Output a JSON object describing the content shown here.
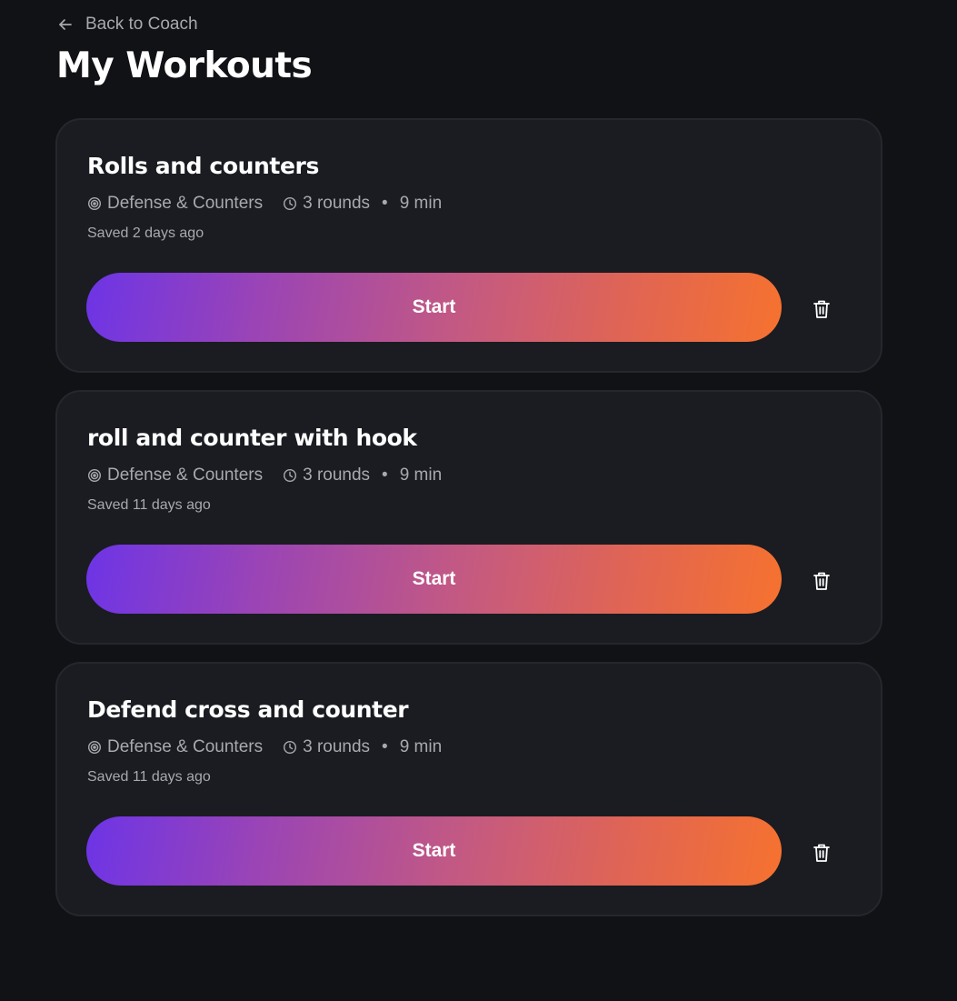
{
  "nav": {
    "back_label": "Back to Coach"
  },
  "page": {
    "title": "My Workouts"
  },
  "workouts": [
    {
      "title": "Rolls and counters",
      "category": "Defense & Counters",
      "rounds": "3 rounds",
      "duration": "9 min",
      "saved": "Saved 2 days ago",
      "start_label": "Start"
    },
    {
      "title": "roll and counter with hook",
      "category": "Defense & Counters",
      "rounds": "3 rounds",
      "duration": "9 min",
      "saved": "Saved 11 days ago",
      "start_label": "Start"
    },
    {
      "title": "Defend cross and counter",
      "category": "Defense & Counters",
      "rounds": "3 rounds",
      "duration": "9 min",
      "saved": "Saved 11 days ago",
      "start_label": "Start"
    }
  ],
  "meta_separator": "•",
  "icons": {
    "back": "arrow-left-icon",
    "category": "target-icon",
    "duration": "clock-icon",
    "delete": "trash-icon"
  },
  "colors": {
    "background": "#111215",
    "card": "#1a1c21",
    "muted_text": "#a8a9ae",
    "gradient_start": "#6d34e6",
    "gradient_end": "#f6722f"
  }
}
